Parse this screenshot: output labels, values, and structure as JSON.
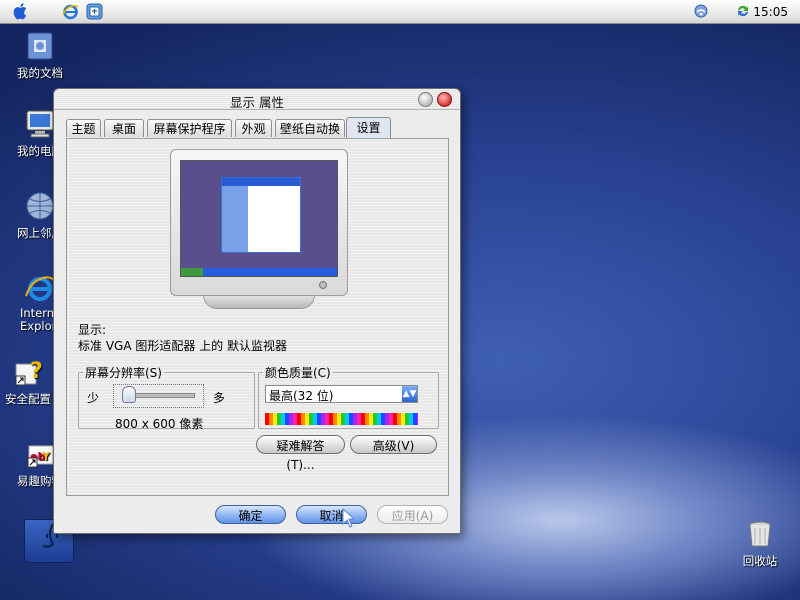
{
  "menubar": {
    "apple_icon": "apple-logo-icon",
    "app_icons": [
      "ie-icon",
      "finder-icon"
    ],
    "tray_icons": [
      "wifi-icon",
      "sync-icon"
    ],
    "clock": "15:05"
  },
  "desktop": {
    "icons": [
      {
        "label": "我的文档",
        "icon": "documents-folder-icon"
      },
      {
        "label": "我的电脑",
        "icon": "computer-icon"
      },
      {
        "label": "网上邻居",
        "icon": "network-globe-icon"
      },
      {
        "label": "Internet Explorer",
        "icon": "ie-icon"
      },
      {
        "label": "安全配置",
        "icon": "security-config-icon"
      },
      {
        "label": "易趣购物",
        "icon": "shopping-icon"
      },
      {
        "label": "回收站",
        "icon": "trash-icon"
      }
    ]
  },
  "window": {
    "title": "显示 属性",
    "tabs": [
      "主题",
      "桌面",
      "屏幕保护程序",
      "外观",
      "壁纸自动换",
      "设置"
    ],
    "active_tab": "设置",
    "display_label": "显示:",
    "display_value": "标准 VGA 图形适配器 上的 默认监视器",
    "resolution": {
      "legend": "屏幕分辨率(S)",
      "less": "少",
      "more": "多",
      "value": "800 x 600 像素"
    },
    "color_quality": {
      "legend": "颜色质量(C)",
      "selected": "最高(32 位)"
    },
    "buttons": {
      "troubleshoot": "疑难解答(T)...",
      "advanced": "高级(V)",
      "ok": "确定",
      "cancel": "取消",
      "apply": "应用(A)"
    }
  }
}
